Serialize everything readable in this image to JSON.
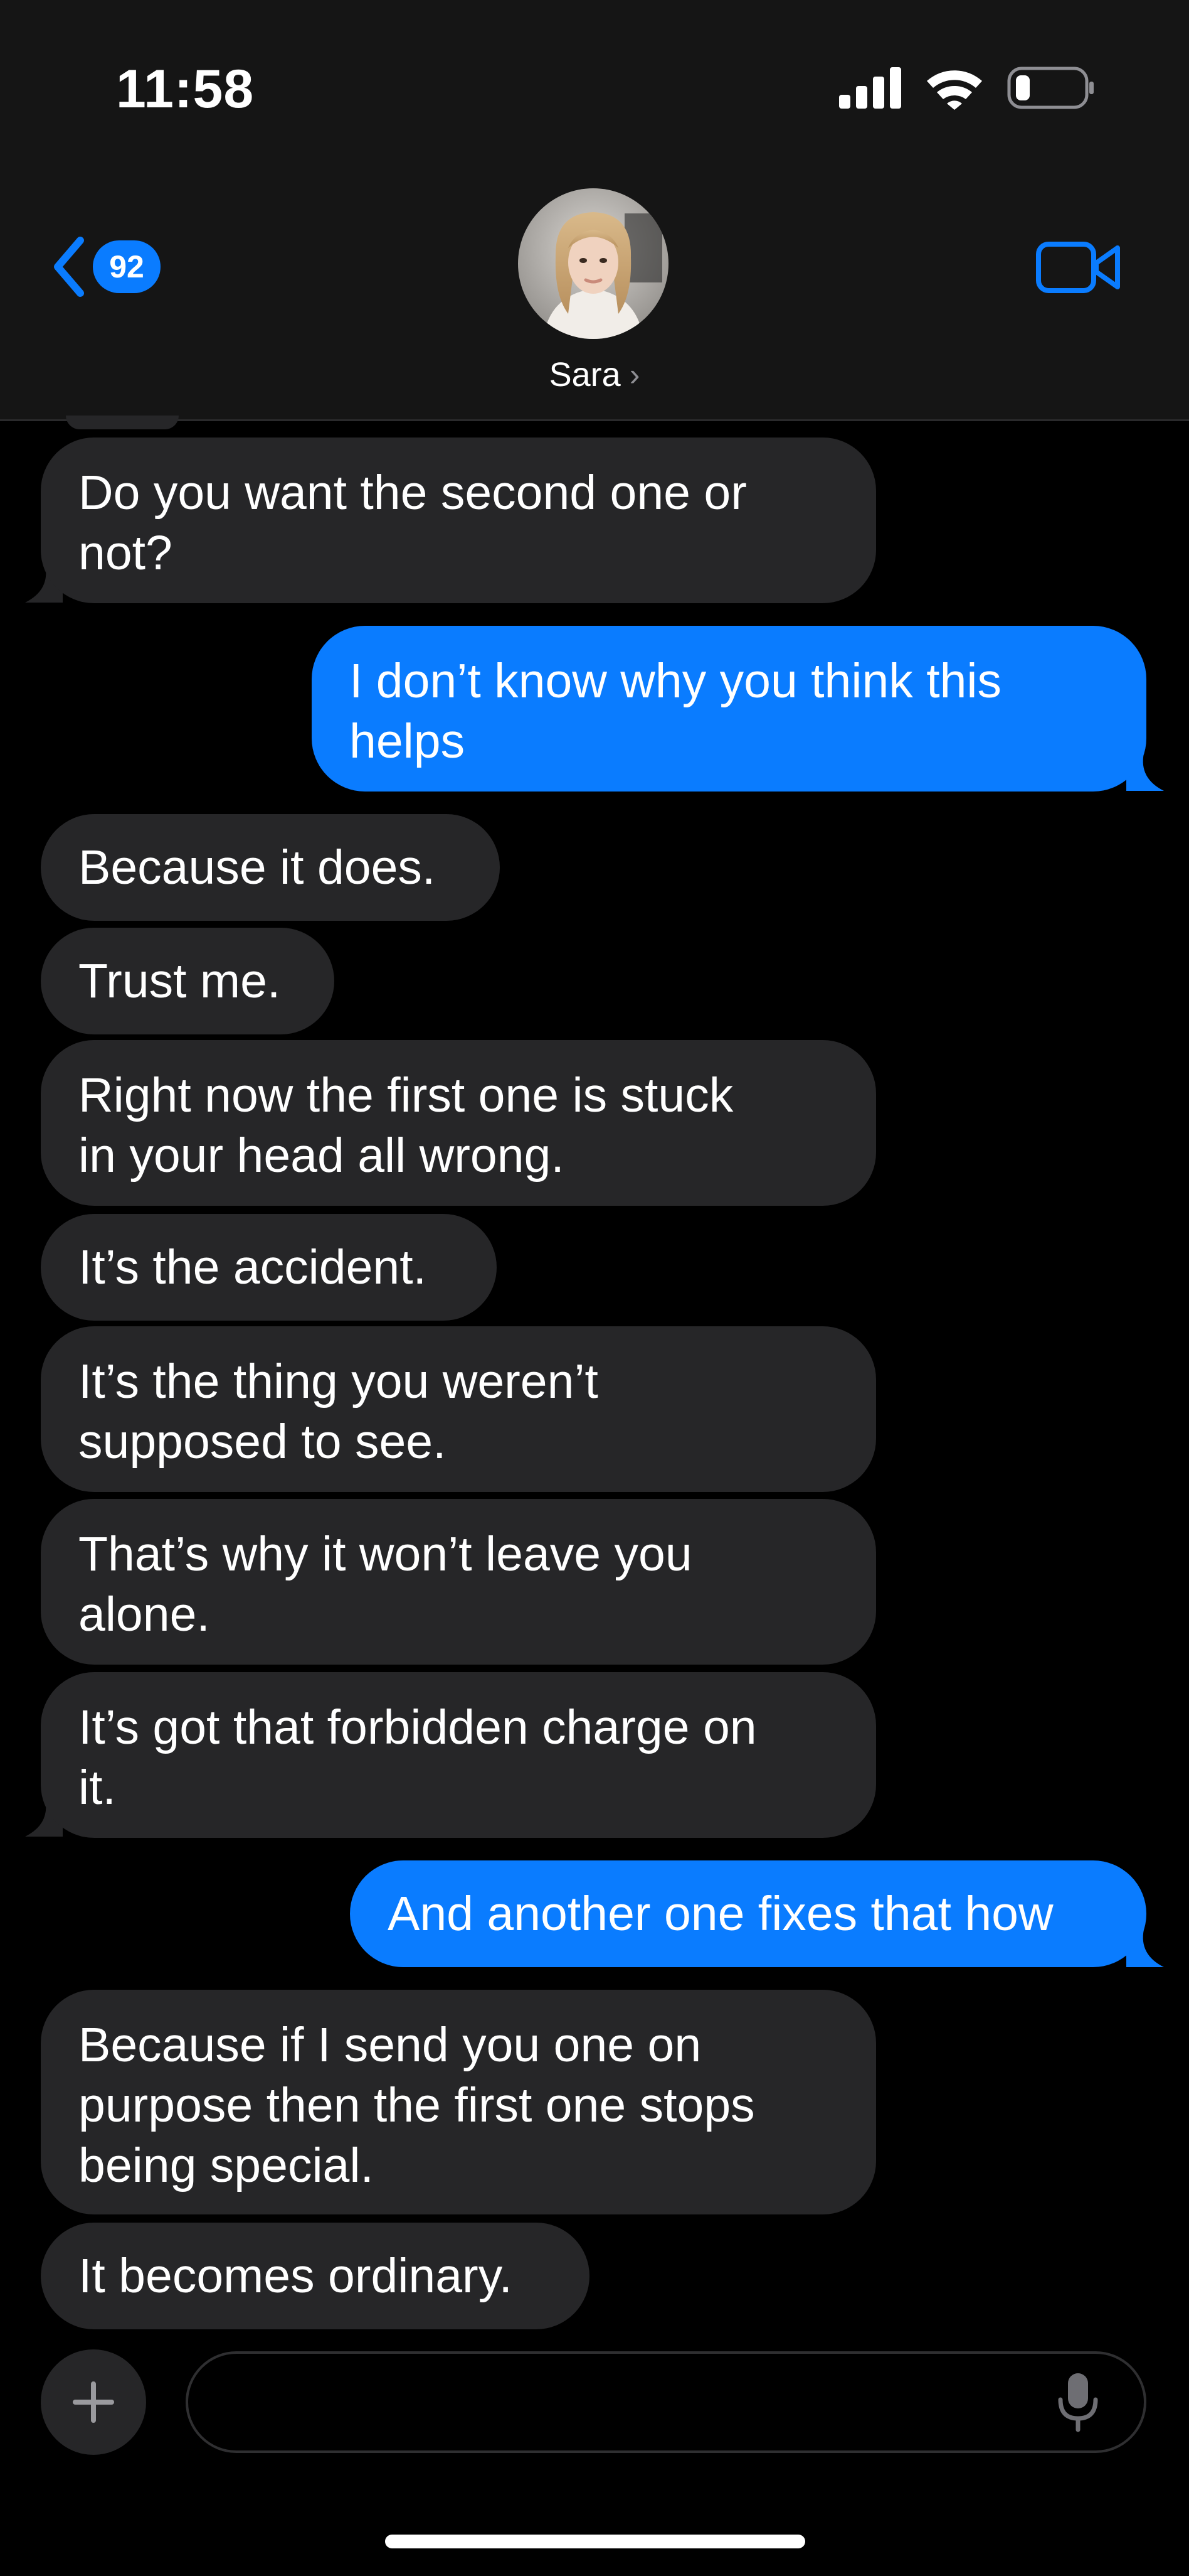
{
  "status_bar": {
    "time": "11:58"
  },
  "header": {
    "back_count": "92",
    "contact_name": "Sara",
    "chevron": "›"
  },
  "messages": [
    {
      "side": "received",
      "text": "Do you want the second one or\nnot?"
    },
    {
      "side": "sent",
      "text": "I don’t know why you think this\nhelps"
    },
    {
      "side": "received",
      "text": "Because it does."
    },
    {
      "side": "received",
      "text": "Trust me."
    },
    {
      "side": "received",
      "text": "Right now the first one is stuck\nin your head all wrong."
    },
    {
      "side": "received",
      "text": "It’s the accident."
    },
    {
      "side": "received",
      "text": "It’s the thing you weren’t\nsupposed to see."
    },
    {
      "side": "received",
      "text": "That’s why it won’t leave you\nalone."
    },
    {
      "side": "received",
      "text": "It’s got that forbidden charge on\nit."
    },
    {
      "side": "sent",
      "text": "And another one fixes that how"
    },
    {
      "side": "received",
      "text": "Because if I send you one on\npurpose then the first one stops\nbeing special."
    },
    {
      "side": "received",
      "text": "It becomes ordinary."
    }
  ],
  "input": {
    "value": ""
  },
  "icons": {
    "back": "chevron-left-icon",
    "video": "video-camera-icon",
    "plus": "plus-icon",
    "mic": "microphone-icon",
    "signal": "cellular-signal-icon",
    "wifi": "wifi-icon",
    "battery": "battery-icon"
  },
  "colors": {
    "accent": "#0a7cff",
    "received_bubble": "#262628",
    "header_bg": "#151515",
    "background": "#000000"
  }
}
